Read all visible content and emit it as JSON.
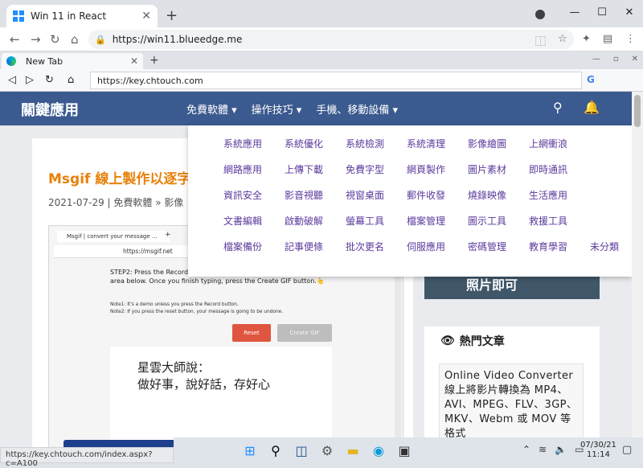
{
  "outer_browser": {
    "tab_title": "Win 11 in React",
    "url": "https://win11.blueedge.me",
    "window_controls": [
      "—",
      "☐",
      "✕"
    ]
  },
  "inner_browser": {
    "tab_title": "New Tab",
    "url": "https://key.chtouch.com",
    "window_controls": [
      "—",
      "▫",
      "✕"
    ]
  },
  "site": {
    "logo": "關鍵應用",
    "menu": [
      "免費軟體 ▾",
      "操作技巧 ▾",
      "手機、移動設備 ▾"
    ],
    "article_title": "Msgif 線上製作以逐字",
    "article_meta": "2021-07-29 | 免費軟體 » 影像",
    "mega_menu": [
      "系統應用",
      "系統優化",
      "系統檢測",
      "系統清理",
      "影像繪圖",
      "上網衝浪",
      "",
      "網路應用",
      "上傳下載",
      "免費字型",
      "網頁製作",
      "圖片素材",
      "即時通訊",
      "",
      "資訊安全",
      "影音視聽",
      "視窗桌面",
      "郵件收發",
      "燒錄映像",
      "生活應用",
      "",
      "文書編輯",
      "啟動破解",
      "螢幕工具",
      "檔案管理",
      "圖示工具",
      "救援工具",
      "",
      "檔案備份",
      "記事便條",
      "批次更名",
      "伺服應用",
      "密碼管理",
      "教育學習",
      "未分類"
    ],
    "sidebar_ad_text": "照片即可",
    "hot_articles_title": "熱門文章",
    "hot_article_text": "Online Video Converter 線上將影片轉換為 MP4、AVI、MPEG、FLV、3GP、MKV、Webm 或 MOV 等格式"
  },
  "screenshot": {
    "tab": "Msgif | convert your message ...",
    "url": "https://msgif.net",
    "step2": "STEP2: Press the Record button and type your message in the text area below. Once you finish typing, press the Create GIF button.👆",
    "note1": "Note1: It's a demo unless you press the Record button.",
    "note2": "Note2: If you press the reset button, your message is going to be undone.",
    "reset_label": "Reset",
    "create_label": "Create GIF",
    "quote_line1": "星雲大師說：",
    "quote_line2": "做好事，說好話，存好心"
  },
  "status_url": "https://key.chtouch.com/index.aspx?c=A100",
  "taskbar": {
    "date": "07/30/21",
    "time": "11:14"
  }
}
